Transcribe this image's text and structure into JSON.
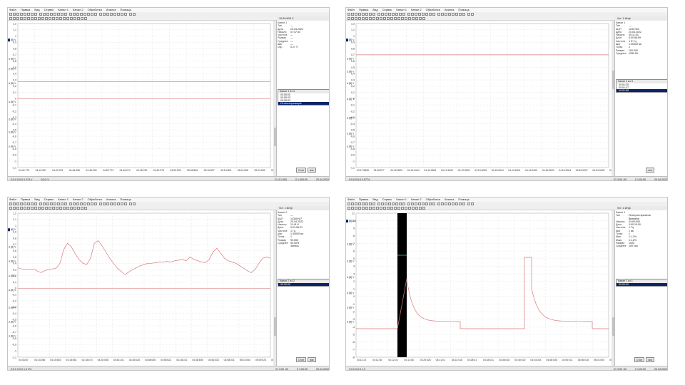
{
  "menu": [
    "Файл",
    "Правка",
    "Вид",
    "Сервис",
    "Канал 1",
    "Канал 2",
    "Обработка",
    "Анализ",
    "Помощь"
  ],
  "panels": [
    {
      "id": "tl",
      "side_title": "10:39.606 V",
      "info": [
        [
          "Канал 1",
          ""
        ],
        [
          "Тип",
          "—"
        ],
        [
          "Дата",
          "20.04.2022"
        ],
        [
          "Начало",
          "07:47:3x"
        ],
        [
          "Частота",
          "—"
        ],
        [
          "Размах",
          "—"
        ],
        [
          "Среднее",
          "—"
        ],
        [
          "Шаг",
          "—"
        ],
        [
          "Uср",
          "0.27 V"
        ]
      ],
      "channels_title": "Канал 1 из 4",
      "channels": [
        "00:55:05",
        "00:55:03",
        "00:55:02",
        "Ихтиостиральция"
      ],
      "selected_channel": 3,
      "x_ticks": [
        "04:42:776",
        "04:10:357",
        "04:43:753",
        "04:46:956",
        "04:48:033",
        "04:52:773",
        "04:46:274",
        "04:48:769",
        "04:49:378",
        "04:50:005",
        "05:05:836",
        "05:10:837",
        "05:10:803",
        "05:24:608",
        "05:24:909",
        "05:58:103"
      ],
      "status_left": "0:0:0 0:0:0 0.274 V",
      "status_mid": "0:0:0 V",
      "status_right1": "21 3:1:300",
      "status_right2": "0 1:000:00",
      "status_right3": "20.04.2022",
      "nav_label": "Стоп",
      "y_labels": [
        "1,2",
        "1,1",
        "1",
        "0,9",
        "0,8",
        "0,7",
        "0,6",
        "0,5",
        "0,4",
        "0,3",
        "0,2",
        "0,1",
        "0",
        "-0,1",
        "-0,2",
        "-0,3",
        "-0,4",
        "-0,5",
        "-0,6",
        "-0,7",
        "-0,8",
        "-0,9",
        "-1",
        "-1,1"
      ],
      "markers": [
        [
          "Δ [В] V",
          0.12
        ],
        [
          "Δ [В] V",
          0.25
        ],
        [
          "Δ [В] V",
          0.32
        ],
        [
          "Δ [В] V",
          0.42
        ],
        [
          "Δ [В] V",
          0.55
        ],
        [
          "Δ [В] V",
          0.67
        ],
        [
          "Δ [В] V",
          0.76
        ],
        [
          "Δ [В] V",
          0.86
        ]
      ],
      "series": [
        0.27,
        0.27
      ],
      "ylim": [
        -1.1,
        1.2
      ],
      "zero_line": 0.0
    },
    {
      "id": "tr",
      "side_title": "Уст. 1 Инф",
      "info": [
        [
          "Канал 1",
          ""
        ],
        [
          "Тип",
          "—"
        ],
        [
          "АЦП",
          "1234+6/2"
        ],
        [
          "Дата",
          "20.04.2022"
        ],
        [
          "Начало",
          "05:11:00"
        ],
        [
          "Длит.",
          "0:00:56:59"
        ],
        [
          "Частота",
          "1 Ф Гц"
        ],
        [
          "Шаг",
          "1.00000 мс"
        ],
        [
          "Точек",
          "1"
        ],
        [
          "Размах",
          "100.000"
        ],
        [
          "Среднее",
          "1280.00"
        ]
      ],
      "channels_title": "Канал 4 из 4",
      "channels": [
        "00:51:25",
        "00:51:47",
        "00:51:58"
      ],
      "selected_channel": 2,
      "x_ticks": [
        "03:17:5850",
        "04:08:577",
        "04:09:0503",
        "04:10:4004",
        "04:11:3906",
        "04:12:4000",
        "04:12:5504",
        "04:13:5005",
        "04:15:6013",
        "04:13:6001",
        "04:14:0003",
        "04:46:8003",
        "04:16:0004",
        "04:52:0007",
        "04:54:0009",
        "04:56:5003"
      ],
      "status_left": "0:0:0 0:0:0 0.5774",
      "status_mid": "",
      "status_right1": "21 3:00 :00",
      "status_right2": "0 1:04:00",
      "status_right3": "20.04.2022",
      "nav_label": "",
      "y_labels": [
        "1,2",
        "1,1",
        "1",
        "0,9",
        "0,8",
        "0,7",
        "0,6",
        "0,5",
        "0,4",
        "0,3",
        "0,2",
        "0,1",
        "0",
        "-0,1",
        "-0,2",
        "-0,3",
        "-0,4",
        "-0,5",
        "-0,6",
        "-0,7",
        "-0,8",
        "-0,9",
        "-1",
        "-1,1"
      ],
      "markers": [
        [
          "Δ [В] V",
          0.12
        ],
        [
          "Δ [В] V",
          0.25
        ],
        [
          "Δ [В] V",
          0.34
        ],
        [
          "Δ [В] V",
          0.42
        ],
        [
          "Δ [В] V",
          0.53
        ],
        [
          "Δ [В] V",
          0.66
        ],
        [
          "Δ [В] V",
          0.77
        ],
        [
          "Δ [В] V",
          0.86
        ]
      ],
      "series": [
        0.7,
        0.7
      ],
      "ylim": [
        -1.1,
        1.2
      ],
      "zero_line": null
    },
    {
      "id": "bl",
      "side_title": "Уст. 1 Инф",
      "info": [
        [
          "Канал 2",
          ""
        ],
        [
          "Тип",
          "—"
        ],
        [
          "АЦП",
          "12345+67"
        ],
        [
          "Дата",
          "20.04.2022"
        ],
        [
          "Начало",
          "11:41:0"
        ],
        [
          "Длит.",
          "0:01:06:01"
        ],
        [
          "Частота",
          "1 Гц"
        ],
        [
          "Шаг",
          "1.00000 мс"
        ],
        [
          "Точек",
          "1"
        ],
        [
          "Размах",
          "90.000"
        ],
        [
          "Среднее",
          "90.00%"
        ],
        [
          "",
          "Запись"
        ]
      ],
      "channels_title": "Канал 2 из 2",
      "channels": [
        "00:00:00"
      ],
      "selected_channel": 0,
      "x_ticks": [
        "04:43:00",
        "04:14:056",
        "04:15:653",
        "04:18:651",
        "04:18:674",
        "04:26:058",
        "04:43:101",
        "04:45:026",
        "04:58:056",
        "04:55:621",
        "04:18:021",
        "04:48:606",
        "04:08:033",
        "04:58:041",
        "05:01:064",
        "05:09:024",
        "05:05:035"
      ],
      "status_left": "0:0:0 0:0:0 1,0 0%",
      "status_mid": "",
      "status_right1": "21 3:00 :00",
      "status_right2": "0 1:00:00",
      "status_right3": "20.04.2022",
      "nav_label": "Стоп",
      "y_labels": [
        "1,2",
        "1,1",
        "1",
        "0,9",
        "0,8",
        "0,7",
        "0,6",
        "0,5",
        "0,4",
        "0,3",
        "0,2",
        "0,1",
        "0",
        "-0,1",
        "-0,2",
        "-0,3",
        "-0,4",
        "-0,5",
        "-0,6",
        "-0,7",
        "-0,8",
        "-0,9",
        "-1",
        "-1,1"
      ],
      "markers": [
        [
          "Δ [В] V",
          0.12
        ],
        [
          "Δ [В] V",
          0.24
        ],
        [
          "Δ [В] V",
          0.34
        ],
        [
          "Δ [В] V",
          0.44
        ],
        [
          "Δ [В] V",
          0.54
        ],
        [
          "Δ [В] V",
          0.66
        ],
        [
          "Δ [В] V",
          0.76
        ],
        [
          "Δ [В] V",
          0.86
        ]
      ],
      "series": [
        0.33,
        0.31,
        0.3,
        0.3,
        0.31,
        0.28,
        0.25,
        0.28,
        0.3,
        0.31,
        0.32,
        0.4,
        0.62,
        0.72,
        0.66,
        0.55,
        0.46,
        0.4,
        0.38,
        0.48,
        0.72,
        0.76,
        0.68,
        0.58,
        0.48,
        0.4,
        0.32,
        0.27,
        0.22,
        0.26,
        0.3,
        0.33,
        0.36,
        0.38,
        0.4,
        0.4,
        0.41,
        0.42,
        0.42,
        0.43,
        0.42,
        0.44,
        0.45,
        0.46,
        0.44,
        0.5,
        0.46,
        0.44,
        0.42,
        0.41,
        0.46,
        0.58,
        0.64,
        0.56,
        0.48,
        0.44,
        0.42,
        0.4,
        0.36,
        0.32,
        0.28,
        0.25,
        0.3,
        0.4,
        0.48,
        0.5,
        0.48
      ],
      "ylim": [
        -1.1,
        1.2
      ],
      "zero_line": 0.0
    },
    {
      "id": "br",
      "side_title": "Уст. 1 Инф",
      "info": [
        [
          "Канал 1",
          ""
        ],
        [
          "Тип",
          "Интеграл времени"
        ],
        [
          "",
          "Времени"
        ],
        [
          "Начало",
          "04:00:000"
        ],
        [
          "Длит.",
          "0:00:10:00"
        ],
        [
          "Частота",
          "1 Гц"
        ],
        [
          "Шаг",
          "1 мс"
        ],
        [
          "Точек",
          "1"
        ],
        [
          "Мин",
          "1:1,3%"
        ],
        [
          "Макс",
          "1:1,8%"
        ],
        [
          "Размах",
          "1000"
        ],
        [
          "Среднее",
          "100 тыс"
        ]
      ],
      "channels_title": "Канал 1 из 1",
      "channels": [
        "00:00:00"
      ],
      "selected_channel": 0,
      "x_ticks": [
        "04:11:10",
        "04:11:48",
        "04:12:04",
        "04:13:48",
        "04:20:025",
        "04:21:01",
        "04:22:018",
        "04:28:01",
        "04:34:011",
        "04:36:016",
        "04:40:020",
        "04:44:024",
        "04:48:036",
        "04:50:011",
        "04:56:018",
        "05:01:000",
        "05:05:002"
      ],
      "status_left": "0:0:0 0:0:0 1,0",
      "status_mid": "",
      "status_right1": "21 3:00 :00",
      "status_right2": "0 1:00:00",
      "status_right3": "20.04.2022",
      "nav_label": "Стоп",
      "y_labels": [
        "11",
        "10",
        "9",
        "8",
        "7",
        "6",
        "5",
        "4",
        "3",
        "2",
        "1",
        "0",
        "-1",
        "-2",
        "-3",
        "-4",
        "-5",
        "-6",
        "-7",
        "-8"
      ],
      "markers": [
        [
          "Δ [В] 1.5",
          0.06
        ],
        [
          "Δ [В] V",
          0.22
        ],
        [
          "Δ [В] V",
          0.34
        ],
        [
          "Δ [В] V",
          0.45
        ],
        [
          "Δ [В] V",
          0.56
        ],
        [
          "Δ [В] V",
          0.66
        ],
        [
          "Δ [В] V",
          0.76
        ]
      ],
      "series": [],
      "ylim": [
        -8,
        11
      ],
      "zero_line": null
    }
  ]
}
